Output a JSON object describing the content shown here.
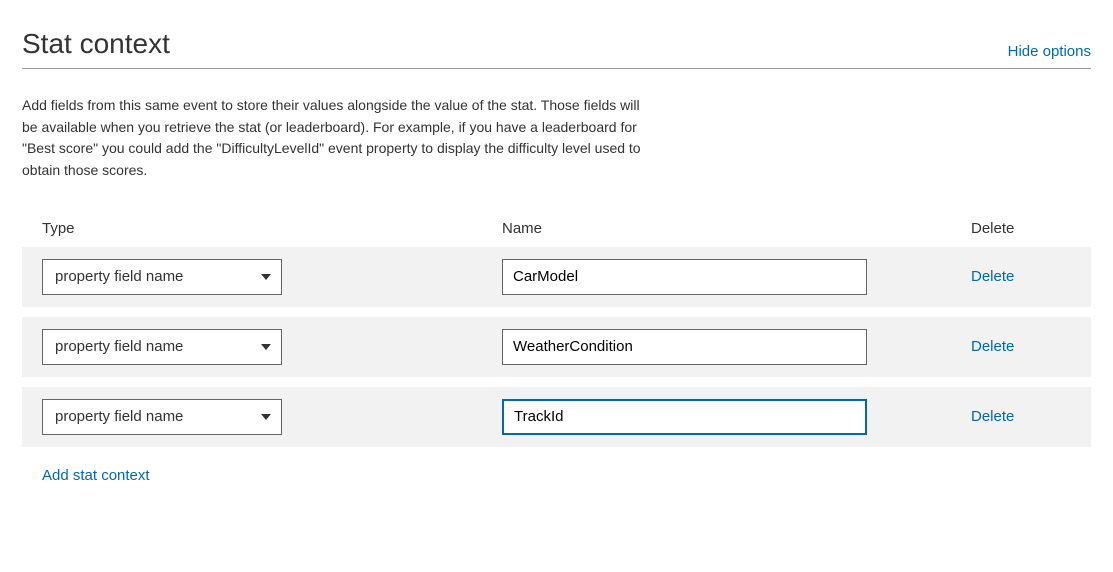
{
  "header": {
    "title": "Stat context",
    "hide_options": "Hide options"
  },
  "description": "Add fields from this same event to store their values alongside the value of the stat. Those fields will be available when you retrieve the stat (or leaderboard). For example, if you have a leaderboard for \"Best score\" you could add the \"DifficultyLevelId\" event property to display the difficulty level used to obtain those scores.",
  "columns": {
    "type": "Type",
    "name": "Name",
    "delete": "Delete"
  },
  "type_option": "property field name",
  "rows": [
    {
      "name": "CarModel",
      "delete_label": "Delete",
      "focused": false
    },
    {
      "name": "WeatherCondition",
      "delete_label": "Delete",
      "focused": false
    },
    {
      "name": "TrackId",
      "delete_label": "Delete",
      "focused": true
    }
  ],
  "add_link": "Add stat context"
}
